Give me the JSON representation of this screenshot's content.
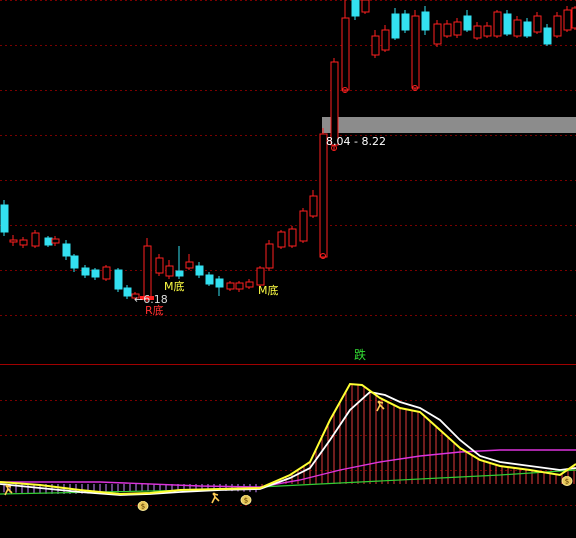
{
  "labels": {
    "price_band": "8.04 - 8.22",
    "low_price": "6.18",
    "low_marker": "R底",
    "m_bottom_1": "M底",
    "m_bottom_2": "M底",
    "signal_fall": "跌"
  },
  "colors": {
    "background": "#000000",
    "grid": "#7a0000",
    "up": "#ff2020",
    "down": "#33e0f0",
    "signal_box": "#8c8c8c",
    "white_line": "#ffffff",
    "yellow_line": "#ffff33",
    "magenta_line": "#dd33dd",
    "green_line": "#33cc33",
    "text_yellow": "#ffff44",
    "text_red": "#ff3030",
    "text_white": "#ffffff",
    "text_green": "#33dd33"
  },
  "icons": [
    "money-bag-icon",
    "person-runner-icon"
  ]
}
